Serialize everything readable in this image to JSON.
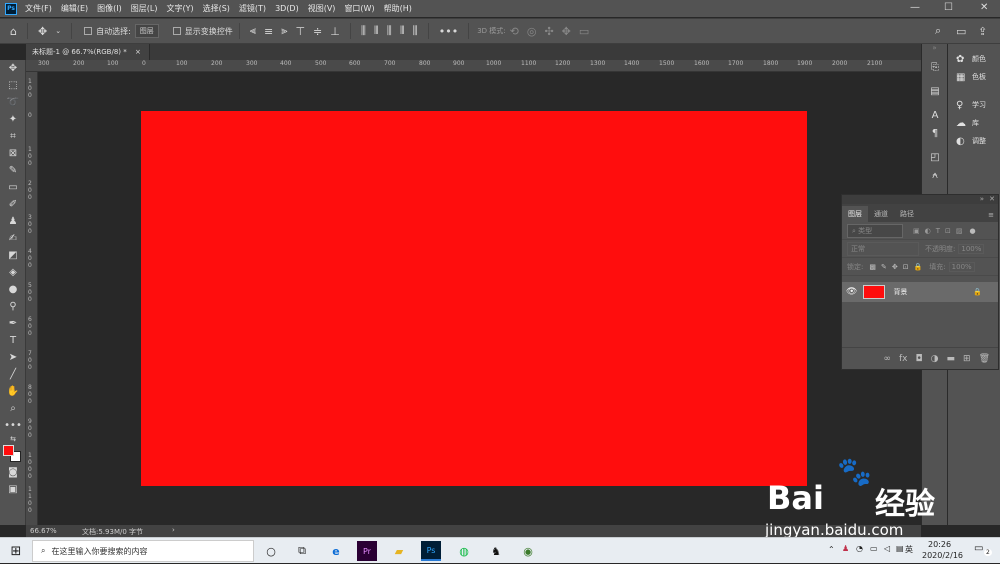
{
  "menubar": {
    "logo": "Ps",
    "items": [
      "文件(F)",
      "编辑(E)",
      "图像(I)",
      "图层(L)",
      "文字(Y)",
      "选择(S)",
      "滤镜(T)",
      "3D(D)",
      "视图(V)",
      "窗口(W)",
      "帮助(H)"
    ],
    "win_min": "—",
    "win_max": "☐",
    "win_close": "✕"
  },
  "options": {
    "auto_select_label": "自动选择:",
    "auto_select_value": "图层",
    "show_transform_label": "显示变换控件",
    "mode_label": "3D 模式:",
    "more": "•••"
  },
  "document": {
    "tab_title": "未标题-1 @ 66.7%(RGB/8) *",
    "tab_close": "×",
    "canvas_color": "#ff0d0d"
  },
  "rulers": {
    "h_ticks": [
      "300",
      "200",
      "100",
      "0",
      "100",
      "200",
      "300",
      "400",
      "500",
      "600",
      "700",
      "800",
      "900",
      "1000",
      "1100",
      "1200",
      "1300",
      "1400",
      "1500",
      "1600",
      "1700",
      "1800",
      "1900",
      "2000",
      "2100"
    ],
    "v_ticks": [
      "1 0 0",
      "0",
      "1 0 0",
      "2 0 0",
      "3 0 0",
      "4 0 0",
      "5 0 0",
      "6 0 0",
      "7 0 0",
      "8 0 0",
      "9 0 0",
      "1 0 0 0",
      "1 1 0 0"
    ]
  },
  "status": {
    "zoom": "66.67%",
    "doc_info": "文档:5.93M/0 字节",
    "arrow": "›"
  },
  "right_panel": {
    "items": [
      {
        "icon": "palette-icon",
        "label": "颜色"
      },
      {
        "icon": "swatches-icon",
        "label": "色板"
      },
      {
        "icon": "learn-icon",
        "label": "学习"
      },
      {
        "icon": "library-icon",
        "label": "库"
      },
      {
        "icon": "adjust-icon",
        "label": "调整"
      }
    ]
  },
  "layers_panel": {
    "tabs": [
      "图层",
      "通道",
      "路径"
    ],
    "filter_placeholder": "类型",
    "blend_mode": "正常",
    "opacity_label": "不透明度:",
    "opacity_value": "100%",
    "lock_label": "锁定:",
    "fill_label": "填充:",
    "fill_value": "100%",
    "layer_name": "背景",
    "layer_thumb_color": "#ff0d0d"
  },
  "taskbar": {
    "search_placeholder": "在这里输入你要搜索的内容",
    "ime": "英",
    "time": "20:26",
    "date": "2020/2/16",
    "notif_count": "2"
  },
  "watermark": {
    "brand_text": "Bai",
    "brand_text2": "经验",
    "url": "jingyan.baidu.com"
  }
}
